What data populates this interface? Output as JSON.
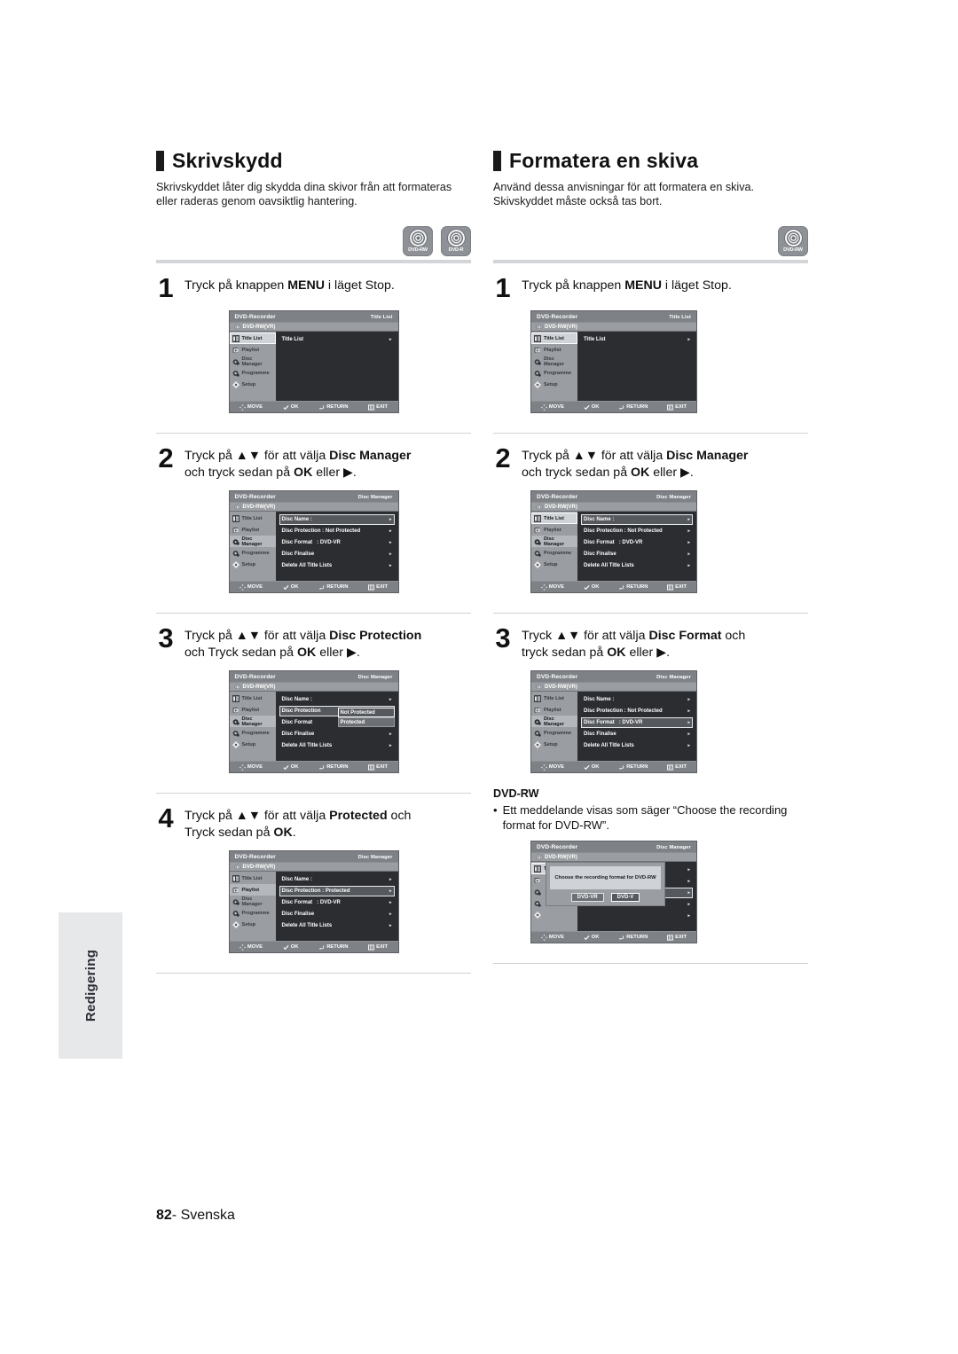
{
  "page": {
    "number": "82",
    "language": "Svenska",
    "side_tab": "Redigering"
  },
  "left": {
    "heading": "Skrivskydd",
    "description": "Skrivskyddet låter dig skydda dina skivor från att formateras eller raderas genom oavsiktlig hantering.",
    "badges": [
      "DVD-RW",
      "DVD-R"
    ],
    "steps": [
      {
        "num": "1",
        "line1_a": "Tryck på knappen ",
        "line1_b": "MENU",
        "line1_c": " i läget Stop.",
        "line2": ""
      },
      {
        "num": "2",
        "line1_a": "Tryck på ▲▼ för att välja ",
        "line1_b": "Disc Manager",
        "line1_c": "",
        "line2_a": "och tryck sedan på ",
        "line2_b": "OK",
        "line2_c": " eller ▶."
      },
      {
        "num": "3",
        "line1_a": "Tryck på  ▲▼ för att välja ",
        "line1_b": "Disc Protection",
        "line1_c": "",
        "line2_a": "och Tryck sedan på ",
        "line2_b": "OK",
        "line2_c": " eller ▶."
      },
      {
        "num": "4",
        "line1_a": "Tryck på  ▲▼ för att välja ",
        "line1_b": "Protected",
        "line1_c": " och",
        "line2_a": "Tryck sedan på ",
        "line2_b": "OK",
        "line2_c": "."
      }
    ]
  },
  "right": {
    "heading": "Formatera en skiva",
    "description": "Använd dessa anvisningar för att formatera en skiva. Skivskyddet måste också tas bort.",
    "badges": [
      "DVD-RW"
    ],
    "steps": [
      {
        "num": "1",
        "line1_a": "Tryck på knappen ",
        "line1_b": "MENU",
        "line1_c": " i läget Stop.",
        "line2": ""
      },
      {
        "num": "2",
        "line1_a": "Tryck på ▲▼ för att välja ",
        "line1_b": "Disc Manager",
        "line1_c": "",
        "line2_a": "och tryck sedan på ",
        "line2_b": "OK",
        "line2_c": " eller ▶."
      },
      {
        "num": "3",
        "line1_a": "Tryck ▲▼ för att välja ",
        "line1_b": "Disc Format",
        "line1_c": " och",
        "line2_a": "tryck sedan på ",
        "line2_b": "OK",
        "line2_c": " eller ▶."
      }
    ],
    "note": {
      "title": "DVD-RW",
      "bullet": "•",
      "text": "Ett meddelande visas som säger “Choose the recording format for DVD-RW”."
    }
  },
  "osd": {
    "device": "DVD-Recorder",
    "disc_label": "DVD-RW(VR)",
    "title_titlelist": "Title List",
    "title_discmanager": "Disc Manager",
    "nav": [
      {
        "label": "Title List",
        "icon": "list-icon"
      },
      {
        "label": "Playlist",
        "icon": "playlist-icon"
      },
      {
        "label": "Disc Manager",
        "icon": "disc-manager-icon"
      },
      {
        "label": "Programme",
        "icon": "programme-icon"
      },
      {
        "label": "Setup",
        "icon": "gear-icon"
      }
    ],
    "footer": [
      {
        "label": "MOVE",
        "icon": "dpad-icon"
      },
      {
        "label": "OK",
        "icon": "ok-icon"
      },
      {
        "label": "RETURN",
        "icon": "return-icon"
      },
      {
        "label": "EXIT",
        "icon": "exit-icon"
      }
    ],
    "rows_titlelist": [
      {
        "label": "Title List",
        "value": ""
      }
    ],
    "rows_discmanager": [
      {
        "label": "Disc Name :",
        "value": ""
      },
      {
        "label": "Disc Protection : Not Protected",
        "value": ""
      },
      {
        "label": "Disc Format",
        "value": ": DVD-VR"
      },
      {
        "label": "Disc Finalise",
        "value": ""
      },
      {
        "label": "Delete All Title Lists",
        "value": ""
      }
    ],
    "rows_protected": [
      {
        "label": "Disc Name :",
        "value": ""
      },
      {
        "label": "Disc Protection : Protected",
        "value": ""
      },
      {
        "label": "Disc Format",
        "value": ": DVD-VR"
      },
      {
        "label": "Disc Finalise",
        "value": ""
      },
      {
        "label": "Delete All Title Lists",
        "value": ""
      }
    ],
    "rows_protection_open": [
      {
        "label": "Disc Name :",
        "value": ""
      },
      {
        "label": "Disc Protection",
        "value": ""
      },
      {
        "label": "Disc Format",
        "value": ""
      },
      {
        "label": "Disc Finalise",
        "value": ""
      },
      {
        "label": "Delete All Title Lists",
        "value": ""
      }
    ],
    "dropdown_protection": [
      "Not Protected",
      "Protected"
    ],
    "dialog": {
      "message": "Choose the recording format for DVD-RW",
      "buttons": [
        "DVD-VR",
        "DVD-V"
      ]
    },
    "arrow": "▸"
  }
}
